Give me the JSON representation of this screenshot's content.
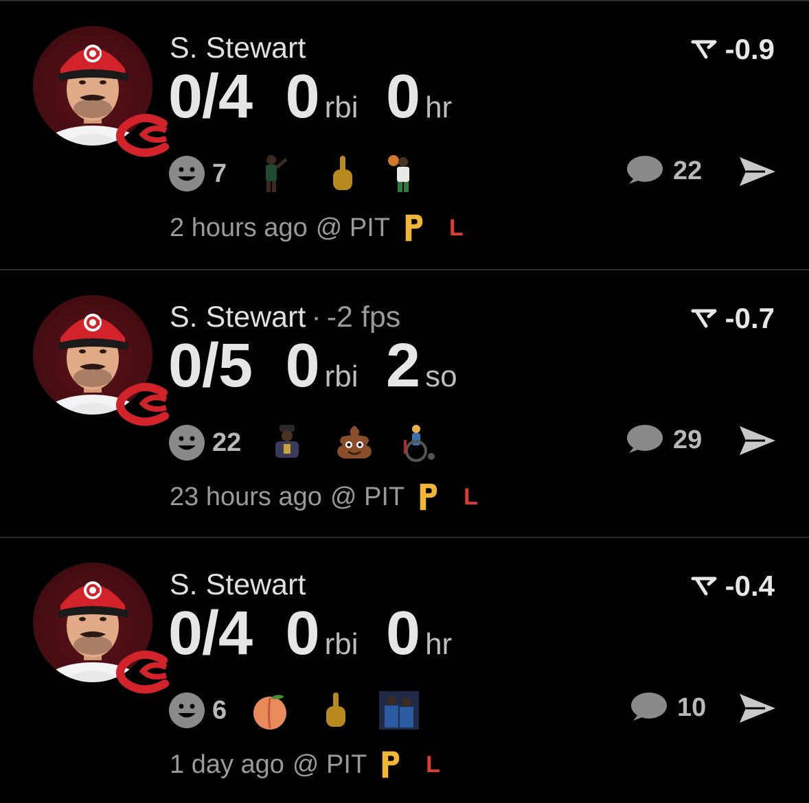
{
  "posts": [
    {
      "player": "S. Stewart",
      "fps": "",
      "score": "-0.9",
      "stat1": "0/4",
      "stat2_value": "0",
      "stat2_label": "rbi",
      "stat3_value": "0",
      "stat3_label": "hr",
      "reaction_count": "7",
      "reactions": [
        "basketball-player-pointing-emoji",
        "middle-finger-emoji",
        "basketball-player-celtics-emoji"
      ],
      "comment_count": "22",
      "time": "2 hours ago",
      "opponent": "@ PIT",
      "result": "L"
    },
    {
      "player": "S. Stewart",
      "fps": "-2 fps",
      "score": "-0.7",
      "stat1": "0/5",
      "stat2_value": "0",
      "stat2_label": "rbi",
      "stat3_value": "2",
      "stat3_label": "so",
      "reaction_count": "22",
      "reactions": [
        "singer-emoji",
        "pile-of-poo-emoji",
        "wheelchair-emoji"
      ],
      "comment_count": "29",
      "time": "23 hours ago",
      "opponent": "@ PIT",
      "result": "L"
    },
    {
      "player": "S. Stewart",
      "fps": "",
      "score": "-0.4",
      "stat1": "0/4",
      "stat2_value": "0",
      "stat2_label": "rbi",
      "stat3_value": "0",
      "stat3_label": "hr",
      "reaction_count": "6",
      "reactions": [
        "peach-emoji",
        "middle-finger-emoji",
        "two-men-emoji"
      ],
      "comment_count": "10",
      "time": "1 day ago",
      "opponent": "@ PIT",
      "result": "L"
    }
  ],
  "colors": {
    "background": "#000000",
    "loss": "#e03a33",
    "pirates_gold": "#f2b636",
    "reds_red": "#d2232a"
  }
}
